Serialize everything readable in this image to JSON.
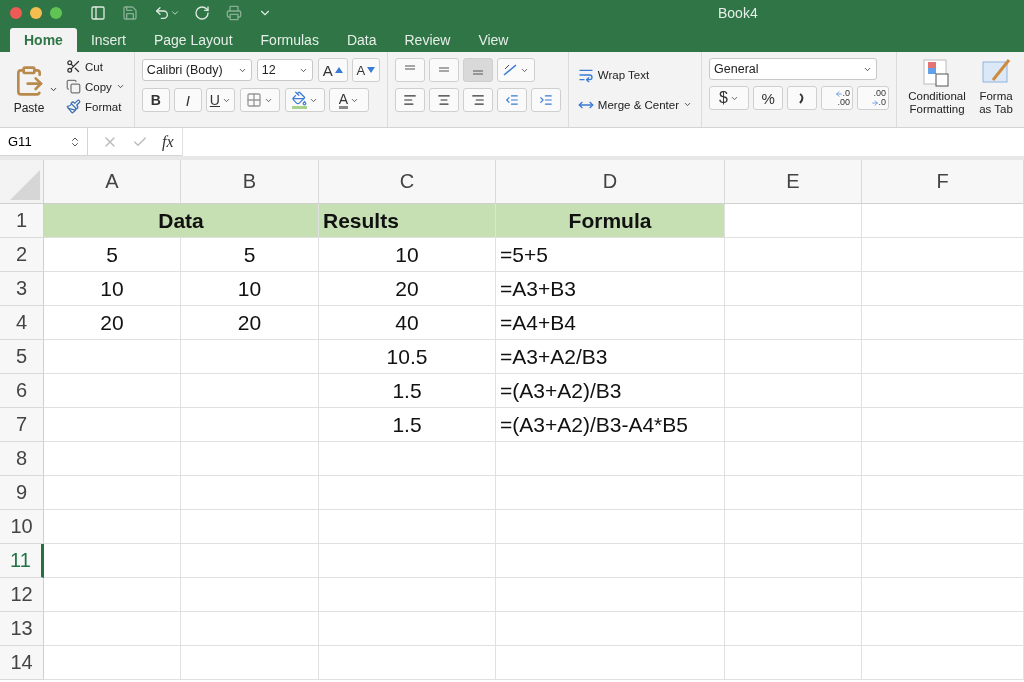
{
  "window": {
    "title": "Book4"
  },
  "tabs": [
    {
      "label": "Home",
      "selected": true
    },
    {
      "label": "Insert",
      "selected": false
    },
    {
      "label": "Page Layout",
      "selected": false
    },
    {
      "label": "Formulas",
      "selected": false
    },
    {
      "label": "Data",
      "selected": false
    },
    {
      "label": "Review",
      "selected": false
    },
    {
      "label": "View",
      "selected": false
    }
  ],
  "clipboard": {
    "paste": "Paste",
    "items": [
      "Cut",
      "Copy",
      "Format"
    ]
  },
  "font": {
    "family": "Calibri (Body)",
    "size": "12",
    "grow": "A",
    "shrink": "A",
    "styles": [
      "B",
      "I",
      "U"
    ],
    "font_color": "A"
  },
  "wrap_text": "Wrap Text",
  "merge": "Merge & Center",
  "number": {
    "format": "General",
    "currency": "$",
    "percent": "%",
    "increase_decimal": [
      ".0",
      ".00"
    ],
    "decrease_decimal": [
      ".00",
      ".0"
    ]
  },
  "styles": [
    "Conditional Formatting",
    "Forma as Tab"
  ],
  "formula_bar": {
    "name_box": "G11",
    "fx": "fx"
  },
  "sheet": {
    "columns": [
      "A",
      "B",
      "C",
      "D",
      "E",
      "F"
    ],
    "rows": [
      {
        "number": "1",
        "selected": false,
        "kind": "header",
        "cells": [
          {
            "text": "Data",
            "kind": "center",
            "merge_next": true
          },
          {
            "text": "Results",
            "kind": "left"
          },
          {
            "text": "Formula",
            "kind": "center"
          }
        ]
      },
      {
        "number": "2",
        "selected": false,
        "kind": "data",
        "cells": [
          {
            "text": "5",
            "kind": "center"
          },
          {
            "text": "5",
            "kind": "center"
          },
          {
            "text": "10",
            "kind": "center"
          },
          {
            "text": "=5+5",
            "kind": "left"
          }
        ]
      },
      {
        "number": "3",
        "selected": false,
        "kind": "data",
        "cells": [
          {
            "text": "10",
            "kind": "center"
          },
          {
            "text": "10",
            "kind": "center"
          },
          {
            "text": "20",
            "kind": "center"
          },
          {
            "text": "=A3+B3",
            "kind": "left"
          }
        ]
      },
      {
        "number": "4",
        "selected": false,
        "kind": "data",
        "cells": [
          {
            "text": "20",
            "kind": "center"
          },
          {
            "text": "20",
            "kind": "center"
          },
          {
            "text": "40",
            "kind": "center"
          },
          {
            "text": "=A4+B4",
            "kind": "left"
          }
        ]
      },
      {
        "number": "5",
        "selected": false,
        "kind": "data",
        "cells": [
          null,
          null,
          {
            "text": "10.5",
            "kind": "center"
          },
          {
            "text": "=A3+A2/B3",
            "kind": "left"
          }
        ]
      },
      {
        "number": "6",
        "selected": false,
        "kind": "data",
        "cells": [
          null,
          null,
          {
            "text": "1.5",
            "kind": "center"
          },
          {
            "text": "=(A3+A2)/B3",
            "kind": "left"
          }
        ]
      },
      {
        "number": "7",
        "selected": false,
        "kind": "data",
        "cells": [
          null,
          null,
          {
            "text": "1.5",
            "kind": "center"
          },
          {
            "text": "=(A3+A2)/B3-A4*B5",
            "kind": "left"
          }
        ]
      },
      {
        "number": "8",
        "selected": false,
        "kind": "data",
        "cells": []
      },
      {
        "number": "9",
        "selected": false,
        "kind": "data",
        "cells": []
      },
      {
        "number": "10",
        "selected": false,
        "kind": "data",
        "cells": []
      },
      {
        "number": "11",
        "selected": true,
        "kind": "data",
        "cells": []
      },
      {
        "number": "12",
        "selected": false,
        "kind": "data",
        "cells": []
      },
      {
        "number": "13",
        "selected": false,
        "kind": "data",
        "cells": []
      },
      {
        "number": "14",
        "selected": false,
        "kind": "data",
        "cells": []
      }
    ]
  }
}
